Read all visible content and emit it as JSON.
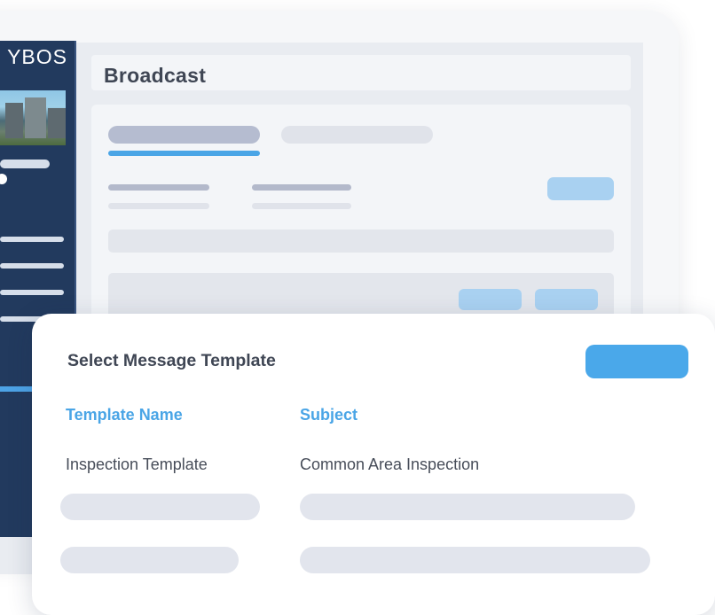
{
  "app": {
    "logo_text": "YBOS"
  },
  "header": {
    "title": "Broadcast"
  },
  "dialog": {
    "title": "Select Message Template",
    "columns": [
      "Template Name",
      "Subject"
    ],
    "rows": [
      {
        "template_name": "Inspection Template",
        "subject": "Common Area Inspection"
      }
    ]
  },
  "colors": {
    "accent": "#4aa8ea",
    "sidebar": "#223a5e",
    "heading": "#3f4654"
  }
}
